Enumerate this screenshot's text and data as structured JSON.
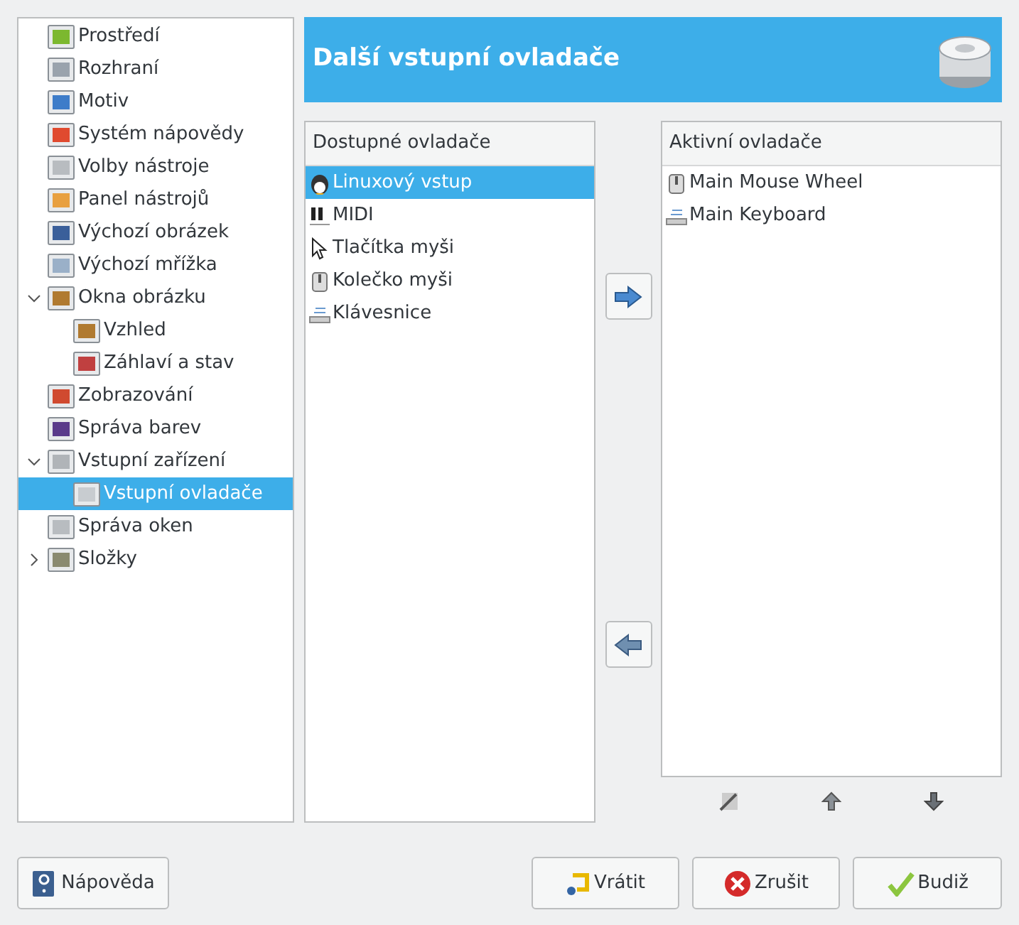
{
  "tree": [
    {
      "label": "Prostředí",
      "selected": false
    },
    {
      "label": "Rozhraní",
      "selected": false
    },
    {
      "label": "Motiv",
      "selected": false
    },
    {
      "label": "Systém nápovědy",
      "selected": false
    },
    {
      "label": "Volby nástroje",
      "selected": false
    },
    {
      "label": "Panel nástrojů",
      "selected": false
    },
    {
      "label": "Výchozí obrázek",
      "selected": false
    },
    {
      "label": "Výchozí mřížka",
      "selected": false
    },
    {
      "label": "Okna obrázku",
      "selected": false,
      "expanded": true,
      "children": [
        {
          "label": "Vzhled",
          "selected": false
        },
        {
          "label": "Záhlaví a stav",
          "selected": false
        }
      ]
    },
    {
      "label": "Zobrazování",
      "selected": false
    },
    {
      "label": "Správa barev",
      "selected": false
    },
    {
      "label": "Vstupní zařízení",
      "selected": false,
      "expanded": true,
      "children": [
        {
          "label": "Vstupní ovladače",
          "selected": true
        }
      ]
    },
    {
      "label": "Správa oken",
      "selected": false
    },
    {
      "label": "Složky",
      "selected": false,
      "expanded": false
    }
  ],
  "header": {
    "title": "Další vstupní ovladače"
  },
  "available": {
    "heading": "Dostupné ovladače",
    "items": [
      {
        "label": "Linuxový vstup",
        "selected": true,
        "kind": "linux"
      },
      {
        "label": "MIDI",
        "selected": false,
        "kind": "midi"
      },
      {
        "label": "Tlačítka myši",
        "selected": false,
        "kind": "pointer"
      },
      {
        "label": "Kolečko myši",
        "selected": false,
        "kind": "wheel"
      },
      {
        "label": "Klávesnice",
        "selected": false,
        "kind": "keyboard"
      }
    ]
  },
  "active": {
    "heading": "Aktivní ovladače",
    "items": [
      {
        "label": "Main Mouse Wheel",
        "selected": false,
        "kind": "wheel"
      },
      {
        "label": "Main Keyboard",
        "selected": false,
        "kind": "keyboard"
      }
    ]
  },
  "buttons": {
    "help": "Nápověda",
    "reset": "Vrátit",
    "cancel": "Zrušit",
    "ok": "Budiž"
  }
}
